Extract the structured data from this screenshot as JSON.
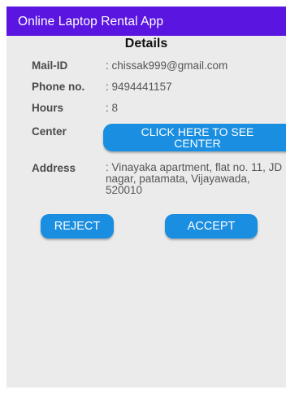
{
  "app_bar": {
    "title": "Online Laptop Rental App",
    "color": "#5a15e0"
  },
  "details": {
    "heading": "Details",
    "fields": [
      {
        "label": "Mail-ID",
        "value": ": chissak999@gmail.com"
      },
      {
        "label": "Phone no.",
        "value": ": 9494441157"
      },
      {
        "label": "Hours",
        "value": ": 8"
      },
      {
        "label": "Center",
        "button": "CLICK HERE TO SEE CENTER"
      },
      {
        "label": "Address",
        "value": ": Vinayaka apartment, flat no. 11, JD nagar, patamata, Vijayawada, 520010"
      }
    ],
    "see_center_line1": "CLICK HERE TO SEE",
    "see_center_line2": "CENTER"
  },
  "actions": {
    "reject_label": "REJECT",
    "accept_label": "ACCEPT",
    "button_color": "#1a8ee0"
  }
}
